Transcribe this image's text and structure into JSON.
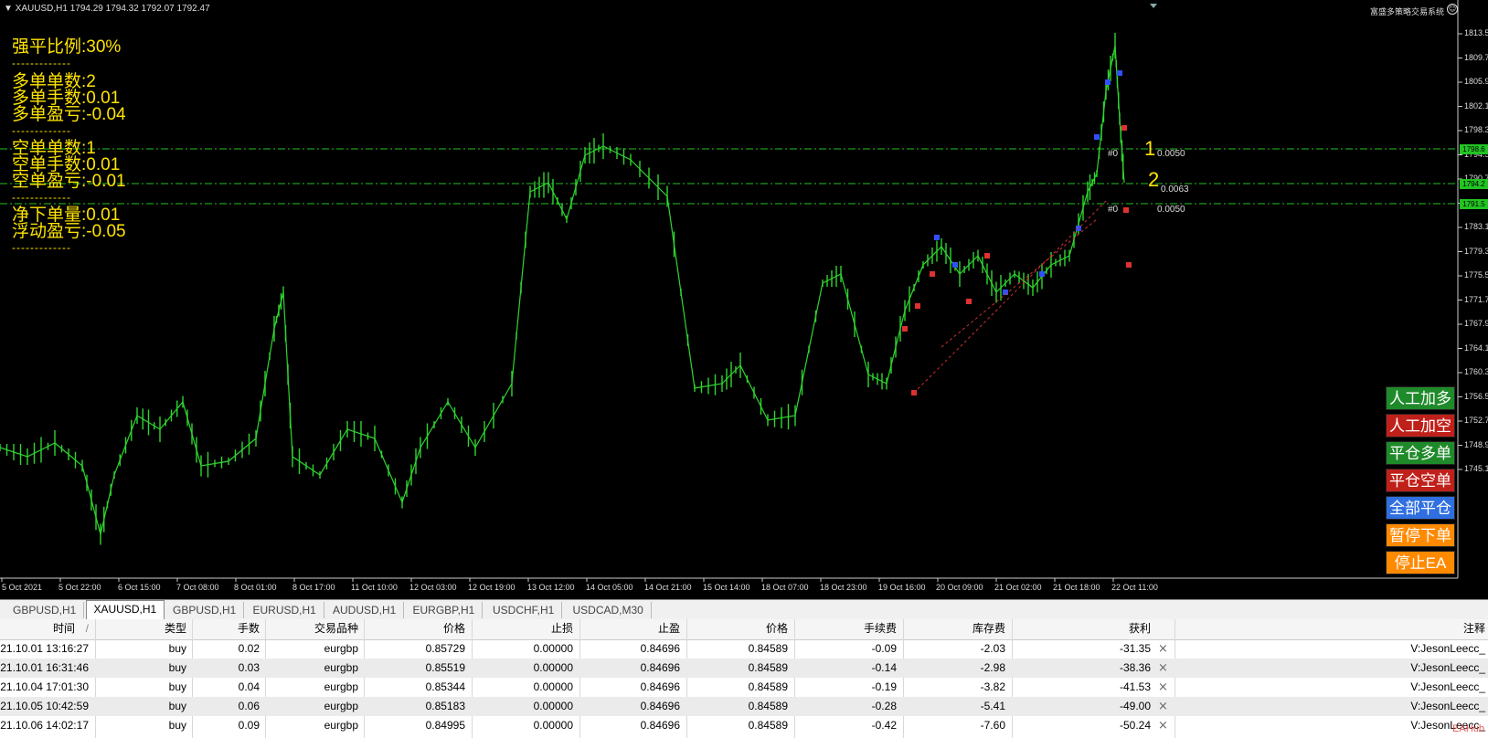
{
  "header": {
    "symbol_info": "XAUUSD,H1  1794.29 1794.32 1792.07 1792.47",
    "brand": "富盛多策略交易系统"
  },
  "info_panel": {
    "force_close_ratio": "强平比例:30%",
    "separator": "-------------",
    "long_count": "多单单数:2",
    "long_lots": "多单手数:0.01",
    "long_pnl": "多单盈亏:-0.04",
    "short_count": "空单单数:1",
    "short_lots": "空单手数:0.01",
    "short_pnl": "空单盈亏:-0.01",
    "net_lots": "净下单量:0.01",
    "floating_pnl": "浮动盈亏:-0.05"
  },
  "buttons": {
    "manual_long": "人工加多",
    "manual_short": "人工加空",
    "close_long": "平仓多单",
    "close_short": "平仓空单",
    "close_all": "全部平仓",
    "pause_orders": "暂停下单",
    "stop_ea": "停止EA"
  },
  "colors": {
    "candle": "#2fd62f",
    "hline": "#22c422",
    "info_text": "#ffe400",
    "btn_green": "#1f8a2a",
    "btn_red": "#c0201a",
    "btn_blue": "#2f6fe0",
    "btn_orange": "#ff8a00"
  },
  "price_axis": [
    "1813.5",
    "1809.7",
    "1805.9",
    "1802.1",
    "1798.3",
    "1794.5",
    "1790.7",
    "1786.9",
    "1783.1",
    "1779.3",
    "1775.5",
    "1771.7",
    "1767.9",
    "1764.1",
    "1760.3",
    "1756.5",
    "1752.7",
    "1748.9",
    "1745.1"
  ],
  "price_tags": {
    "upper": "1798.6",
    "middle": "1794.2",
    "lower": "1791.5"
  },
  "order_labels": {
    "upper": "#0",
    "upper_value": "0.0050",
    "middle_value": "0.0063",
    "lower_prefix": "#0",
    "lower_value": "0.0050",
    "n1": "1",
    "n2": "2"
  },
  "time_axis": [
    "5 Oct 2021",
    "5 Oct 22:00",
    "6 Oct 15:00",
    "7 Oct 08:00",
    "8 Oct 01:00",
    "8 Oct 17:00",
    "11 Oct 10:00",
    "12 Oct 03:00",
    "12 Oct 19:00",
    "13 Oct 12:00",
    "14 Oct 05:00",
    "14 Oct 21:00",
    "15 Oct 14:00",
    "18 Oct 07:00",
    "18 Oct 23:00",
    "19 Oct 16:00",
    "20 Oct 09:00",
    "21 Oct 02:00",
    "21 Oct 18:00",
    "22 Oct 11:00"
  ],
  "tabs": [
    "GBPUSD,H1",
    "XAUUSD,H1",
    "GBPUSD,H1",
    "EURUSD,H1",
    "AUDUSD,H1",
    "EURGBP,H1",
    "USDCHF,H1",
    "USDCAD,M30"
  ],
  "orders": {
    "headers": [
      "时间",
      "类型",
      "手数",
      "交易品种",
      "价格",
      "止损",
      "止盈",
      "价格",
      "手续费",
      "库存费",
      "获利",
      "注释"
    ],
    "sort_indicator": "/",
    "rows": [
      [
        "21.10.01 13:16:27",
        "buy",
        "0.02",
        "eurgbp",
        "0.85729",
        "0.00000",
        "0.84696",
        "0.84589",
        "-0.09",
        "-2.03",
        "-31.35",
        "V:JesonLeecc_"
      ],
      [
        "21.10.01 16:31:46",
        "buy",
        "0.03",
        "eurgbp",
        "0.85519",
        "0.00000",
        "0.84696",
        "0.84589",
        "-0.14",
        "-2.98",
        "-38.36",
        "V:JesonLeecc_"
      ],
      [
        "21.10.04 17:01:30",
        "buy",
        "0.04",
        "eurgbp",
        "0.85344",
        "0.00000",
        "0.84696",
        "0.84589",
        "-0.19",
        "-3.82",
        "-41.53",
        "V:JesonLeecc_"
      ],
      [
        "21.10.05 10:42:59",
        "buy",
        "0.06",
        "eurgbp",
        "0.85183",
        "0.00000",
        "0.84696",
        "0.84589",
        "-0.28",
        "-5.41",
        "-49.00",
        "V:JesonLeecc_"
      ],
      [
        "21.10.06 14:02:17",
        "buy",
        "0.09",
        "eurgbp",
        "0.84995",
        "0.00000",
        "0.84696",
        "0.84589",
        "-0.42",
        "-7.60",
        "-50.24",
        "V:JesonLeecc_"
      ]
    ]
  },
  "watermark": "EAHub"
}
